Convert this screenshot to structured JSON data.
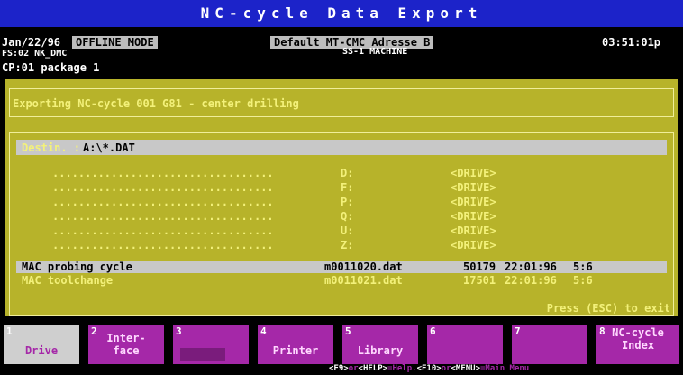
{
  "title": "NC-cycle Data Export",
  "status": {
    "date": "Jan/22/96",
    "mode": "OFFLINE MODE",
    "address": "Default MT-CMC Adresse B",
    "machine": "SS-1 MACHINE",
    "time": "03:51:01p",
    "line2": "FS:02 NK_DMC",
    "line3": "CP:01 package 1"
  },
  "exporting_text": "Exporting NC-cycle 001 G81 - center drilling",
  "destination": {
    "label": "Destin. :",
    "value": "A:\\*.DAT"
  },
  "dots": "..................................",
  "drives": [
    {
      "letter": "D:",
      "tag": "<DRIVE>"
    },
    {
      "letter": "F:",
      "tag": "<DRIVE>"
    },
    {
      "letter": "P:",
      "tag": "<DRIVE>"
    },
    {
      "letter": "Q:",
      "tag": "<DRIVE>"
    },
    {
      "letter": "U:",
      "tag": "<DRIVE>"
    },
    {
      "letter": "Z:",
      "tag": "<DRIVE>"
    }
  ],
  "files": [
    {
      "name": "MAC probing cycle",
      "file": "m0011020.dat",
      "size": "50179",
      "date": "22:01:96",
      "ver": "5:6"
    },
    {
      "name": "MAC toolchange",
      "file": "m0011021.dat",
      "size": "17501",
      "date": "22:01:96",
      "ver": "5:6"
    }
  ],
  "press_esc": "Press (ESC) to exit",
  "fkeys": [
    {
      "num": "1",
      "label": "Drive"
    },
    {
      "num": "2",
      "label": "Inter-\nface"
    },
    {
      "num": "3",
      "label": ""
    },
    {
      "num": "4",
      "label": "Printer"
    },
    {
      "num": "5",
      "label": "Library"
    },
    {
      "num": "6",
      "label": ""
    },
    {
      "num": "7",
      "label": ""
    },
    {
      "num": "8",
      "label": "NC-cycle\nIndex"
    }
  ],
  "bottom_help": {
    "k1": "<F9>",
    "t1": "or",
    "k2": "<HELP>",
    "t2": "=Help.",
    "k3": "<F10>",
    "t3": "or",
    "k4": "<MENU>",
    "t4": "=Main Menu"
  },
  "colors": {
    "title_bg": "#1c23c9",
    "panel": "#b7b32a",
    "text_yellow": "#f3f17a",
    "fkey": "#a528a8",
    "selection": "#c8c8c8"
  }
}
